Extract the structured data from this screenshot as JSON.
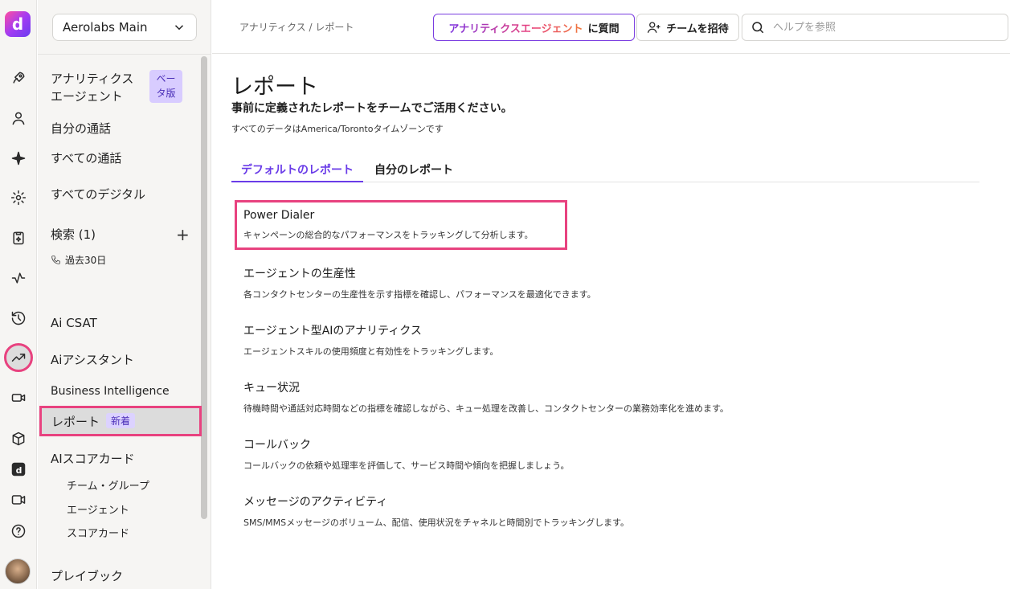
{
  "workspace": {
    "name": "Aerolabs Main"
  },
  "rail": {
    "logo_letter": "d",
    "icons": [
      "rocket-icon",
      "user-icon",
      "sparkle-icon",
      "gear-icon",
      "clipboard-icon",
      "pulse-icon",
      "history-icon",
      "trending-up-icon",
      "camera-icon",
      "box-icon",
      "dialpad-logo-icon",
      "video-icon",
      "help-icon"
    ],
    "active": "trending-up-icon"
  },
  "sidebar": {
    "analytics_agent": {
      "label": "アナリティクス\nエージェント",
      "badge": "ベー\nタ版"
    },
    "my_calls": "自分の通話",
    "all_calls": "すべての通話",
    "all_digital": "すべてのデジタル",
    "search": {
      "label": "検索 (1)",
      "add": "+"
    },
    "saved_search": "過去30日",
    "ai_csat": "Ai CSAT",
    "ai_assistant": "Aiアシスタント",
    "business_intelligence": "Business Intelligence",
    "reports": {
      "label": "レポート",
      "badge": "新着"
    },
    "ai_scorecard": "AIスコアカード",
    "team_group": "チーム・グループ",
    "agent": "エージェント",
    "scorecard": "スコアカード",
    "playbook": "プレイブック"
  },
  "topbar": {
    "breadcrumb": "アナリティクス / レポート",
    "ask_highlight": "アナリティクスエージェント",
    "ask_suffix": "に質問",
    "invite": "チームを招待",
    "search_placeholder": "ヘルプを参照"
  },
  "main": {
    "title": "レポート",
    "subtitle": "事前に定義されたレポートをチームでご活用ください。",
    "timezone_note": "すべてのデータはAmerica/Torontoタイムゾーンです",
    "tabs": [
      {
        "label": "デフォルトのレポート",
        "active": true
      },
      {
        "label": "自分のレポート",
        "active": false
      }
    ],
    "reports": [
      {
        "title": "Power Dialer",
        "desc": "キャンペーンの総合的なパフォーマンスをトラッキングして分析します。"
      },
      {
        "title": "エージェントの生産性",
        "desc": "各コンタクトセンターの生産性を示す指標を確認し、パフォーマンスを最適化できます。"
      },
      {
        "title": "エージェント型AIのアナリティクス",
        "desc": "エージェントスキルの使用頻度と有効性をトラッキングします。"
      },
      {
        "title": "キュー状況",
        "desc": "待機時間や通話対応時間などの指標を確認しながら、キュー処理を改善し、コンタクトセンターの業務効率化を進めます。"
      },
      {
        "title": "コールバック",
        "desc": "コールバックの依頼や処理率を評価して、サービス時間や傾向を把握しましょう。"
      },
      {
        "title": "メッセージのアクティビティ",
        "desc": "SMS/MMSメッセージのボリューム、配信、使用状況をチャネルと時間別でトラッキングします。"
      }
    ]
  },
  "colors": {
    "accent": "#6a3ce8",
    "highlight": "#e8427f"
  }
}
